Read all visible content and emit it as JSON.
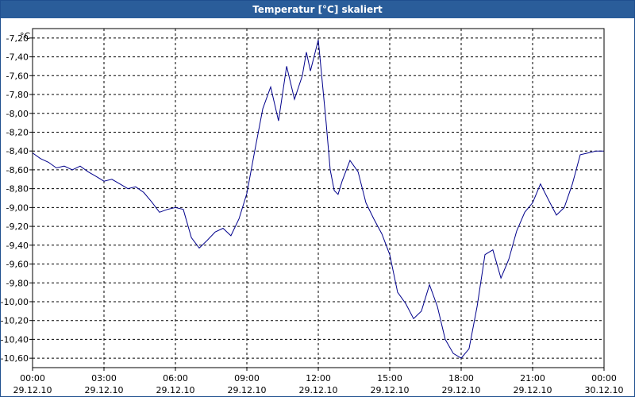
{
  "window": {
    "title": "Temperatur [°C] skaliert"
  },
  "chart_data": {
    "type": "line",
    "title": "Temperatur [°C] skaliert",
    "ylabel": "°C",
    "xlabel": "",
    "ylim": [
      -10.7,
      -7.1
    ],
    "y_ticks": [
      "-7,20",
      "-7,40",
      "-7,60",
      "-7,80",
      "-8,00",
      "-8,20",
      "-8,40",
      "-8,60",
      "-8,80",
      "-9,00",
      "-9,20",
      "-9,40",
      "-9,60",
      "-9,80",
      "-10,00",
      "-10,20",
      "-10,40",
      "-10,60"
    ],
    "y_tick_values": [
      -7.2,
      -7.4,
      -7.6,
      -7.8,
      -8.0,
      -8.2,
      -8.4,
      -8.6,
      -8.8,
      -9.0,
      -9.2,
      -9.4,
      -9.6,
      -9.8,
      -10.0,
      -10.2,
      -10.4,
      -10.6
    ],
    "x_ticks": [
      {
        "time": "00:00",
        "date": "29.12.10"
      },
      {
        "time": "03:00",
        "date": "29.12.10"
      },
      {
        "time": "06:00",
        "date": "29.12.10"
      },
      {
        "time": "09:00",
        "date": "29.12.10"
      },
      {
        "time": "12:00",
        "date": "29.12.10"
      },
      {
        "time": "15:00",
        "date": "29.12.10"
      },
      {
        "time": "18:00",
        "date": "29.12.10"
      },
      {
        "time": "21:00",
        "date": "29.12.10"
      },
      {
        "time": "00:00",
        "date": "30.12.10"
      }
    ],
    "grid": true,
    "line_color": "#00008b",
    "series": [
      {
        "x_hours": [
          0,
          0.33,
          0.67,
          1.0,
          1.33,
          1.67,
          2.0,
          2.33,
          2.67,
          3.0,
          3.33,
          3.67,
          4.0,
          4.33,
          4.67,
          5.0,
          5.33,
          5.67,
          6.0,
          6.33,
          6.67,
          7.0,
          7.33,
          7.67,
          8.0,
          8.33,
          8.67,
          9.0,
          9.33,
          9.67,
          10.0,
          10.33,
          10.67,
          11.0,
          11.33,
          11.5,
          11.67,
          12.0,
          12.33,
          12.5,
          12.67,
          12.83,
          13.0,
          13.33,
          13.67,
          14.0,
          14.33,
          14.67,
          15.0,
          15.33,
          15.67,
          16.0,
          16.33,
          16.67,
          17.0,
          17.33,
          17.67,
          18.0,
          18.33,
          18.67,
          19.0,
          19.33,
          19.67,
          20.0,
          20.33,
          20.67,
          21.0,
          21.33,
          21.67,
          22.0,
          22.33,
          22.67,
          23.0,
          23.33,
          23.67,
          24.0
        ],
        "values": [
          -8.42,
          -8.48,
          -8.52,
          -8.58,
          -8.56,
          -8.6,
          -8.56,
          -8.62,
          -8.67,
          -8.72,
          -8.7,
          -8.75,
          -8.8,
          -8.78,
          -8.84,
          -8.94,
          -9.05,
          -9.02,
          -9.0,
          -9.02,
          -9.32,
          -9.43,
          -9.35,
          -9.26,
          -9.22,
          -9.3,
          -9.12,
          -8.85,
          -8.4,
          -7.95,
          -7.72,
          -8.08,
          -7.5,
          -7.85,
          -7.6,
          -7.35,
          -7.55,
          -7.22,
          -8.1,
          -8.6,
          -8.82,
          -8.86,
          -8.72,
          -8.5,
          -8.62,
          -8.95,
          -9.12,
          -9.28,
          -9.5,
          -9.9,
          -10.02,
          -10.18,
          -10.1,
          -9.82,
          -10.05,
          -10.4,
          -10.55,
          -10.6,
          -10.5,
          -10.05,
          -9.5,
          -9.45,
          -9.75,
          -9.55,
          -9.25,
          -9.05,
          -8.95,
          -8.75,
          -8.92,
          -9.08,
          -9.0,
          -8.75,
          -8.44,
          -8.42,
          -8.4,
          -8.4
        ]
      }
    ]
  }
}
